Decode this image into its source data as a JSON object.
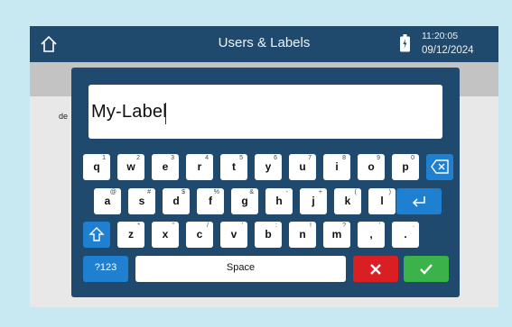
{
  "header": {
    "title": "Users & Labels",
    "time": "11:20:05",
    "date": "09/12/2024"
  },
  "background": {
    "partial_text": "de"
  },
  "keyboard": {
    "input_value": "My-Label",
    "row1": [
      {
        "k": "q",
        "s": "1"
      },
      {
        "k": "w",
        "s": "2"
      },
      {
        "k": "e",
        "s": "3"
      },
      {
        "k": "r",
        "s": "4"
      },
      {
        "k": "t",
        "s": "5"
      },
      {
        "k": "y",
        "s": "6"
      },
      {
        "k": "u",
        "s": "7"
      },
      {
        "k": "i",
        "s": "8"
      },
      {
        "k": "o",
        "s": "9"
      },
      {
        "k": "p",
        "s": "0"
      }
    ],
    "row2": [
      {
        "k": "a",
        "s": "@"
      },
      {
        "k": "s",
        "s": "#"
      },
      {
        "k": "d",
        "s": "$"
      },
      {
        "k": "f",
        "s": "%"
      },
      {
        "k": "g",
        "s": "&"
      },
      {
        "k": "h",
        "s": "-"
      },
      {
        "k": "j",
        "s": "+"
      },
      {
        "k": "k",
        "s": "("
      },
      {
        "k": "l",
        "s": ")"
      }
    ],
    "row3": [
      {
        "k": "z",
        "s": "*"
      },
      {
        "k": "x",
        "s": "\""
      },
      {
        "k": "c",
        "s": "/"
      },
      {
        "k": "v",
        "s": "'"
      },
      {
        "k": "b",
        "s": ":"
      },
      {
        "k": "n",
        "s": "!"
      },
      {
        "k": "m",
        "s": "?"
      },
      {
        "k": ",",
        "s": "'"
      },
      {
        "k": ".",
        "s": "."
      }
    ],
    "mode_label": "?123",
    "space_label": "Space",
    "icons": {
      "backspace": "backspace-icon",
      "enter": "enter-icon",
      "shift": "shift-icon",
      "cancel": "close-icon",
      "confirm": "check-icon",
      "home": "home-icon",
      "battery": "battery-icon"
    },
    "colors": {
      "blue": "#1f7fd0",
      "red": "#d91e24",
      "green": "#3bb34a",
      "panel": "#1f4a6e"
    }
  }
}
